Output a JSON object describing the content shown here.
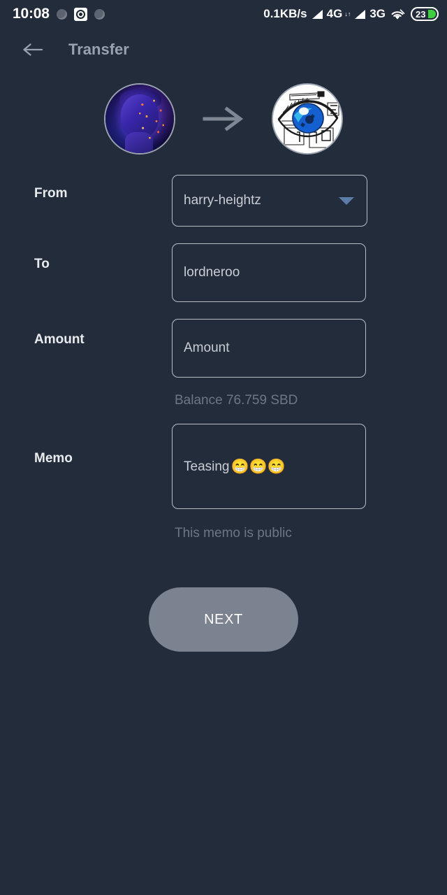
{
  "statusbar": {
    "clock": "10:08",
    "record_icon": "record-icon",
    "dot_left_icon": "circle-indicator-icon",
    "dot_right_icon": "circle-indicator-icon",
    "net_speed": "0.1KB/s",
    "sim1_network": "4G",
    "sim1_sub": "↓↑",
    "sim2_network": "3G",
    "wifi_icon": "wifi-icon",
    "battery_level": "23"
  },
  "appbar": {
    "back_icon": "back-arrow-icon",
    "title": "Transfer"
  },
  "avatars": {
    "from_avatar_name": "avatar-from-harry-heightz",
    "transfer_arrow_icon": "arrow-right-icon",
    "to_avatar_name": "avatar-to-lordneroo"
  },
  "form": {
    "from": {
      "label": "From",
      "value": "harry-heightz",
      "dropdown_icon": "chevron-down-icon"
    },
    "to": {
      "label": "To",
      "value": "lordneroo",
      "placeholder": "To"
    },
    "amount": {
      "label": "Amount",
      "value": "",
      "placeholder": "Amount",
      "balance_hint": "Balance 76.759 SBD"
    },
    "memo": {
      "label": "Memo",
      "value": "Teasing",
      "emoji": "😁😁😁",
      "placeholder": "Memo",
      "hint": "This memo is public"
    }
  },
  "actions": {
    "next_label": "NEXT"
  },
  "colors": {
    "background": "#232c3a",
    "field_border": "#b9bec6",
    "label_text": "#e9ecef",
    "value_text": "#c9ced6",
    "hint_text": "#6e7684",
    "appbar_title": "#98a1ad",
    "dropdown_caret": "#5d7da8",
    "next_button": "#7b8290",
    "battery_fill": "#3fce3f"
  }
}
